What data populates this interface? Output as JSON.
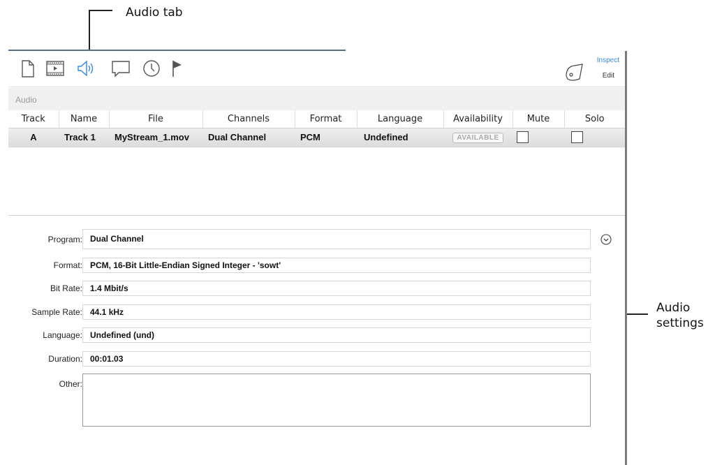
{
  "callouts": {
    "audio_tab": "Audio tab",
    "audio_settings_line1": "Audio",
    "audio_settings_line2": "settings"
  },
  "toolbar": {
    "inspect_label": "Inspect",
    "edit_label": "Edit",
    "active_tab": "audio",
    "accent_color": "#3a86d6"
  },
  "section": {
    "title": "Audio"
  },
  "tracks": {
    "columns": [
      "Track",
      "Name",
      "File",
      "Channels",
      "Format",
      "Language",
      "Availability",
      "Mute",
      "Solo"
    ],
    "rows": [
      {
        "track": "A",
        "name": "Track 1",
        "file": "MyStream_1.mov",
        "channels": "Dual Channel",
        "format": "PCM",
        "language": "Undefined",
        "availability": "AVAILABLE",
        "mute": false,
        "solo": false
      }
    ]
  },
  "settings": {
    "program_label": "Program:",
    "program_value": "Dual Channel",
    "format_label": "Format:",
    "format_value": "PCM, 16-Bit Little-Endian Signed Integer - 'sowt'",
    "bitrate_label": "Bit Rate:",
    "bitrate_value": "1.4 Mbit/s",
    "samplerate_label": "Sample Rate:",
    "samplerate_value": "44.1 kHz",
    "language_label": "Language:",
    "language_value": "Undefined (und)",
    "duration_label": "Duration:",
    "duration_value": "00:01.03",
    "other_label": "Other:",
    "other_value": ""
  }
}
